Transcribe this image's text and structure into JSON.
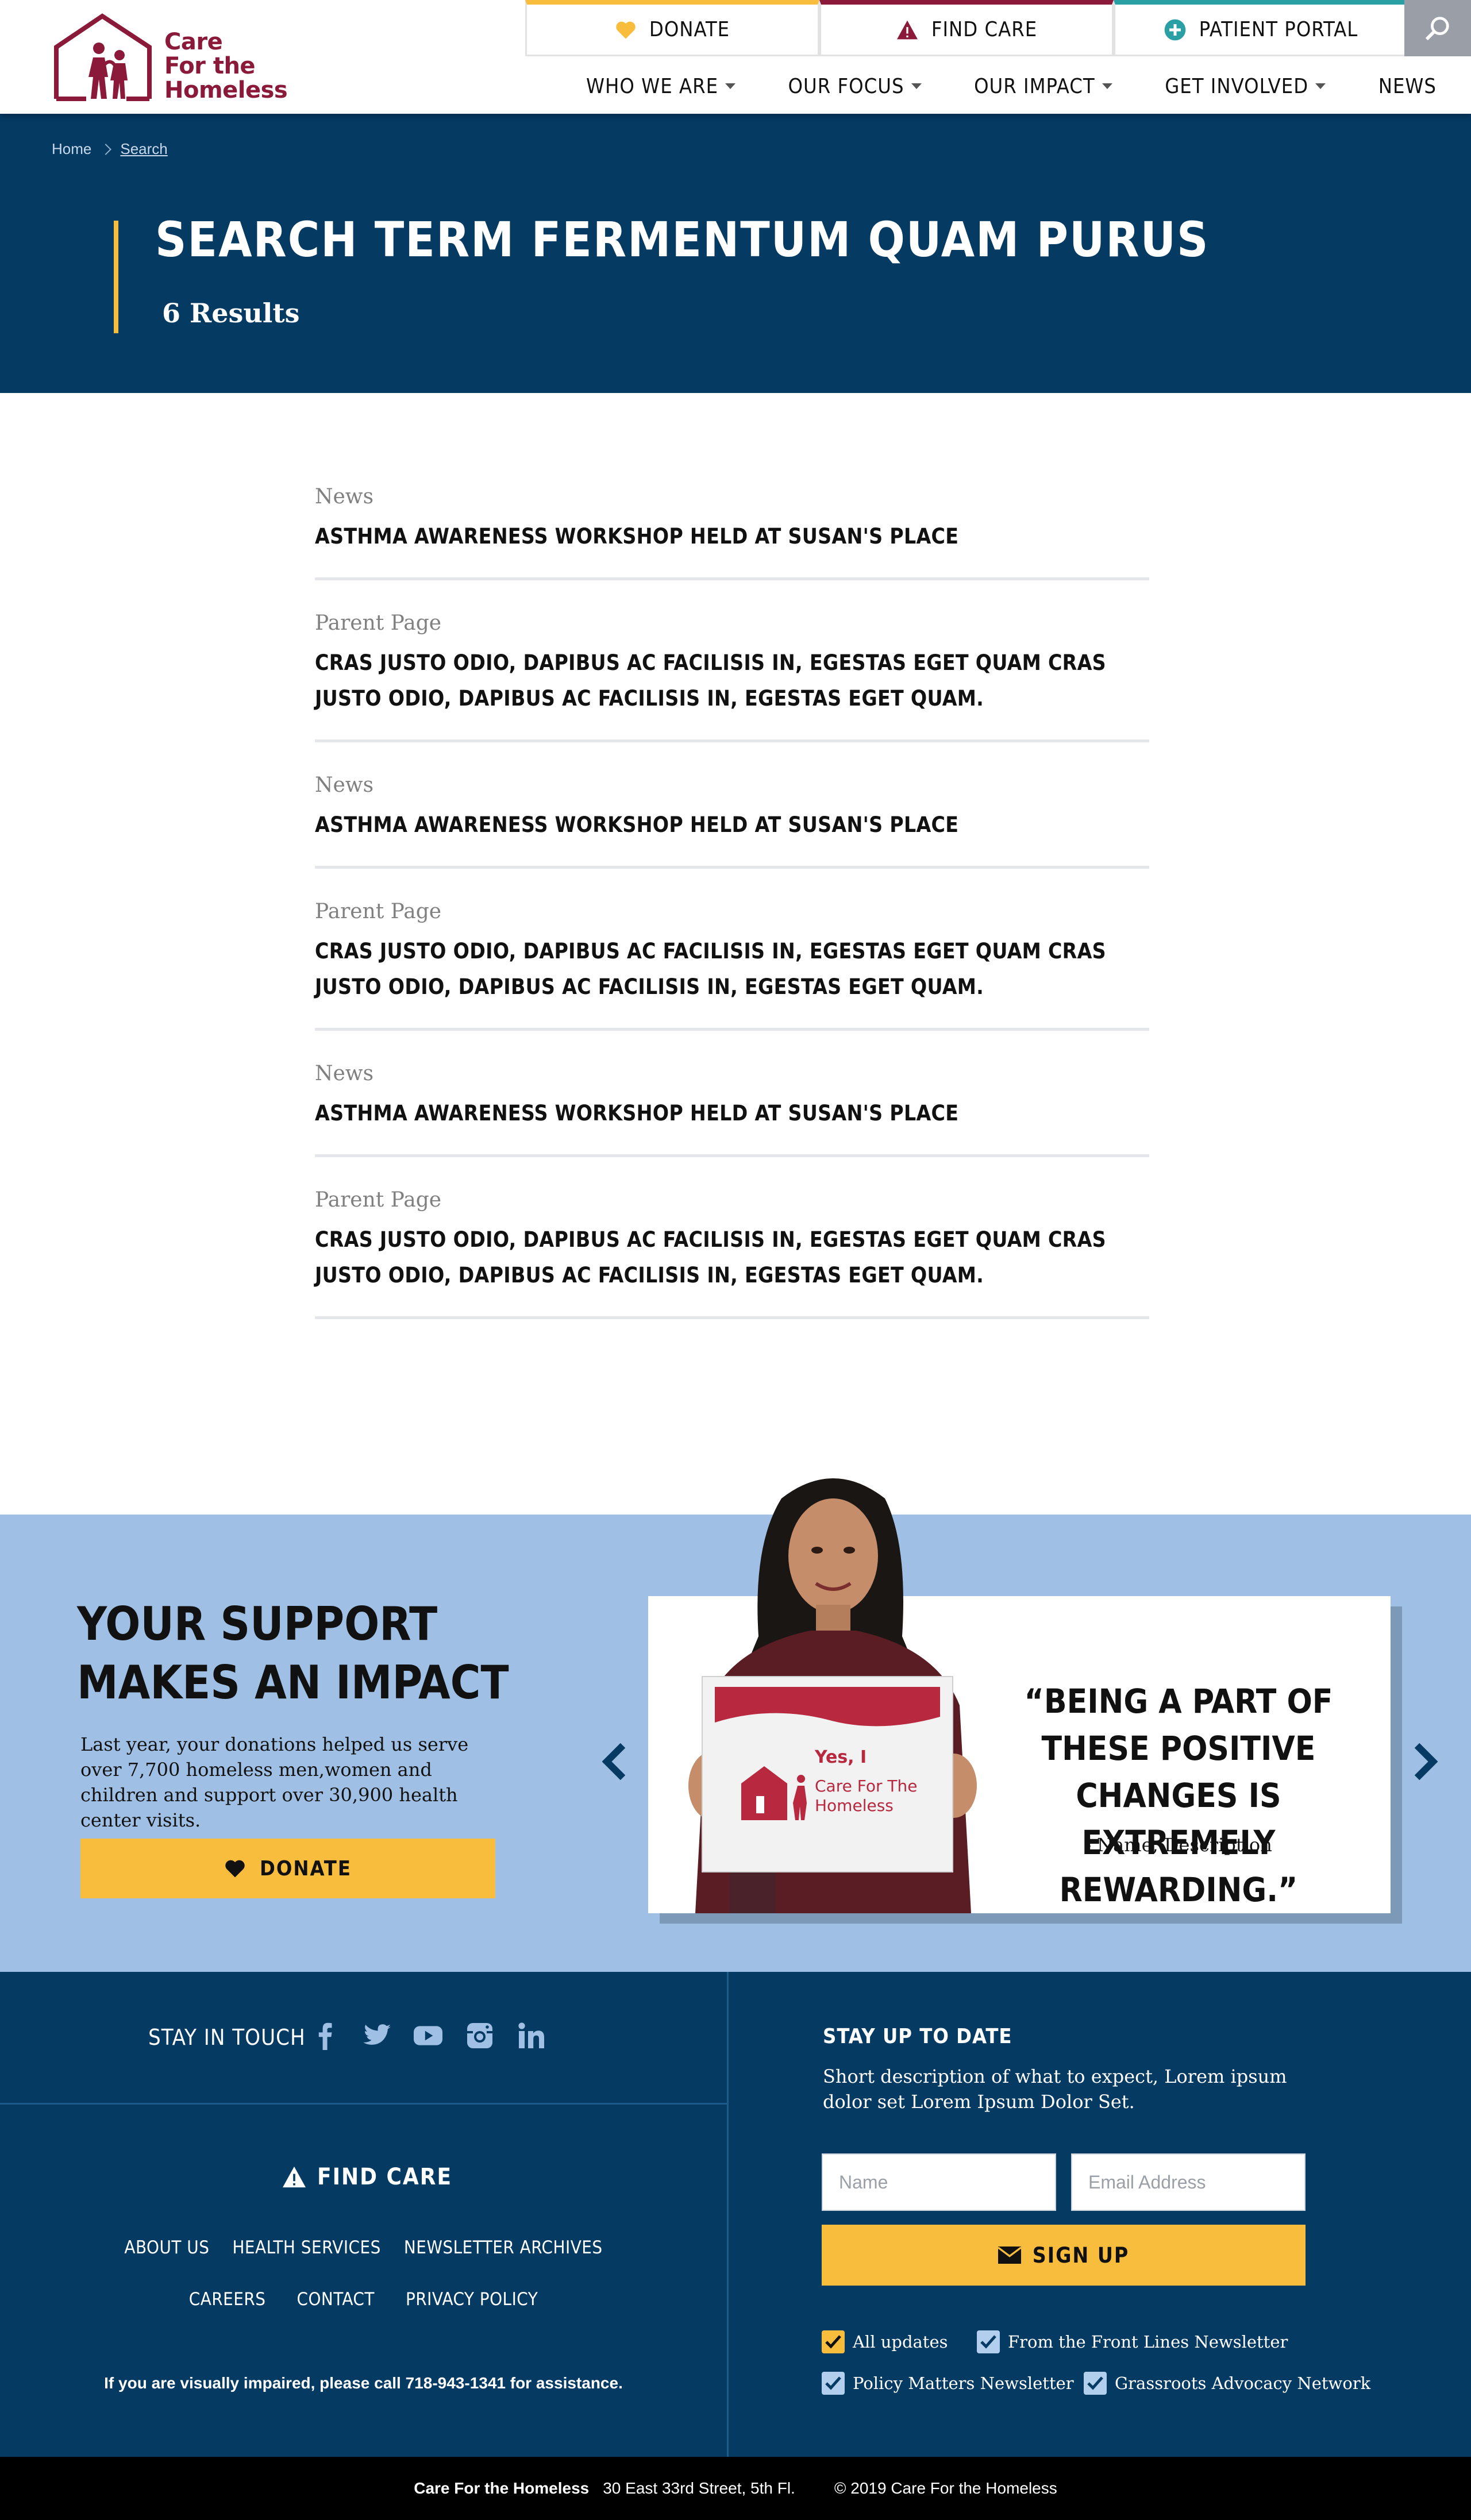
{
  "brand": {
    "logo_lines": [
      "Care",
      "For the",
      "Homeless"
    ],
    "primary_color": "#8b1a3a",
    "navy": "#053a63",
    "accent_yellow": "#f9bd3e"
  },
  "utility_nav": {
    "donate": "DONATE",
    "find_care": "FIND CARE",
    "patient_portal": "PATIENT PORTAL"
  },
  "main_nav": [
    {
      "label": "WHO WE ARE",
      "has_dropdown": true
    },
    {
      "label": "OUR FOCUS",
      "has_dropdown": true
    },
    {
      "label": "OUR IMPACT",
      "has_dropdown": true
    },
    {
      "label": "GET INVOLVED",
      "has_dropdown": true
    },
    {
      "label": "NEWS",
      "has_dropdown": false
    }
  ],
  "breadcrumb": {
    "home": "Home",
    "current": "Search"
  },
  "hero": {
    "title": "SEARCH TERM FERMENTUM QUAM PURUS",
    "count": "6 Results"
  },
  "results": [
    {
      "type": "News",
      "title": "ASTHMA AWARENESS WORKSHOP HELD AT SUSAN'S PLACE"
    },
    {
      "type": "Parent Page",
      "title": "CRAS JUSTO ODIO, DAPIBUS AC FACILISIS IN, EGESTAS EGET QUAM CRAS JUSTO ODIO, DAPIBUS AC FACILISIS IN, EGESTAS EGET QUAM."
    },
    {
      "type": "News",
      "title": "ASTHMA AWARENESS WORKSHOP HELD AT SUSAN'S PLACE"
    },
    {
      "type": "Parent Page",
      "title": "CRAS JUSTO ODIO, DAPIBUS AC FACILISIS IN, EGESTAS EGET QUAM CRAS JUSTO ODIO, DAPIBUS AC FACILISIS IN, EGESTAS EGET QUAM."
    },
    {
      "type": "News",
      "title": "ASTHMA AWARENESS WORKSHOP HELD AT SUSAN'S PLACE"
    },
    {
      "type": "Parent Page",
      "title": "CRAS JUSTO ODIO, DAPIBUS AC FACILISIS IN, EGESTAS EGET QUAM CRAS JUSTO ODIO, DAPIBUS AC FACILISIS IN, EGESTAS EGET QUAM."
    }
  ],
  "support": {
    "title_lines": [
      "YOUR SUPPORT",
      "MAKES AN IMPACT"
    ],
    "text": "Last year, your donations helped us serve over 7,700 homeless men,women and children and support over 30,900 health center visits.",
    "donate_label": "DONATE",
    "sign_lines": [
      "Yes, I",
      "Care For The",
      "Homeless"
    ],
    "quote": "“BEING A PART OF THESE POSITIVE CHANGES IS EXTREMELY REWARDING.”",
    "author": "- Name, Description"
  },
  "footer": {
    "stay_in_touch": "STAY IN TOUCH",
    "socials": [
      "facebook-icon",
      "twitter-icon",
      "youtube-icon",
      "instagram-icon",
      "linkedin-icon"
    ],
    "find_care": "FIND CARE",
    "links_row1": [
      "ABOUT US",
      "HEALTH SERVICES",
      "NEWSLETTER ARCHIVES"
    ],
    "links_row2": [
      "CAREERS",
      "CONTACT",
      "PRIVACY POLICY"
    ],
    "impaired_note": "If you are visually impaired, please call 718-943-1341 for assistance.",
    "stay_up_to_date": "STAY UP TO DATE",
    "description": "Short description of what to expect,  Lorem ipsum dolor set Lorem Ipsum Dolor Set.",
    "name_placeholder": "Name",
    "email_placeholder": "Email Address",
    "signup_label": "SIGN UP",
    "checkboxes": [
      {
        "label": "All updates",
        "checked": true
      },
      {
        "label": "From the Front Lines Newsletter",
        "checked": true
      },
      {
        "label": "Policy Matters Newsletter",
        "checked": true
      },
      {
        "label": "Grassroots Advocacy Network",
        "checked": true
      }
    ]
  },
  "bottom_bar": {
    "org": "Care For the Homeless",
    "address": "30 East 33rd Street, 5th Fl.",
    "copyright": "© 2019 Care For the Homeless"
  }
}
